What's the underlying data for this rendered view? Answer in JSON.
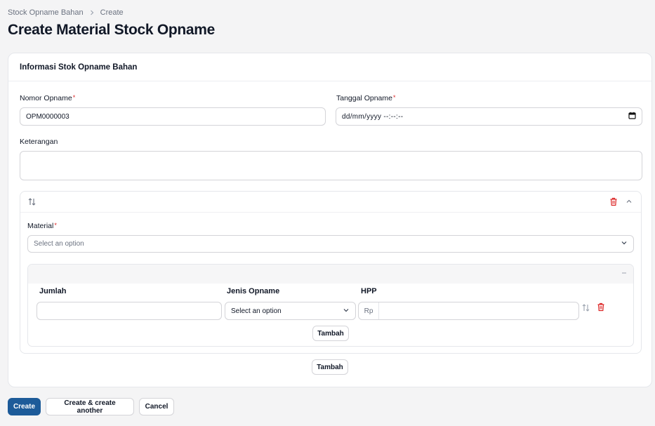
{
  "breadcrumb": {
    "parent": "Stock Opname Bahan",
    "current": "Create"
  },
  "page_title": "Create Material Stock Opname",
  "section": {
    "title": "Informasi Stok Opname Bahan",
    "nomor_label": "Nomor Opname",
    "nomor_value": "OPM0000003",
    "tanggal_label": "Tanggal Opname",
    "tanggal_placeholder": "dd/mm/yyyy  --:--:--",
    "keterangan_label": "Keterangan",
    "keterangan_value": "",
    "required_mark": "*"
  },
  "material_item": {
    "material_label": "Material",
    "material_placeholder": "Select an option",
    "columns": {
      "jumlah": "Jumlah",
      "jenis": "Jenis Opname",
      "hpp": "HPP"
    },
    "jenis_placeholder": "Select an option",
    "hpp_prefix": "Rp",
    "inner_add_label": "Tambah"
  },
  "outer_add_label": "Tambah",
  "actions": {
    "create": "Create",
    "create_another": "Create & create another",
    "cancel": "Cancel"
  },
  "colors": {
    "primary": "#1d5b99",
    "danger": "#dc2626"
  },
  "icons": [
    "chevron-right-icon",
    "calendar-icon",
    "reorder-icon",
    "trash-icon",
    "chevron-up-icon",
    "chevron-down-icon",
    "collapse-icon"
  ]
}
